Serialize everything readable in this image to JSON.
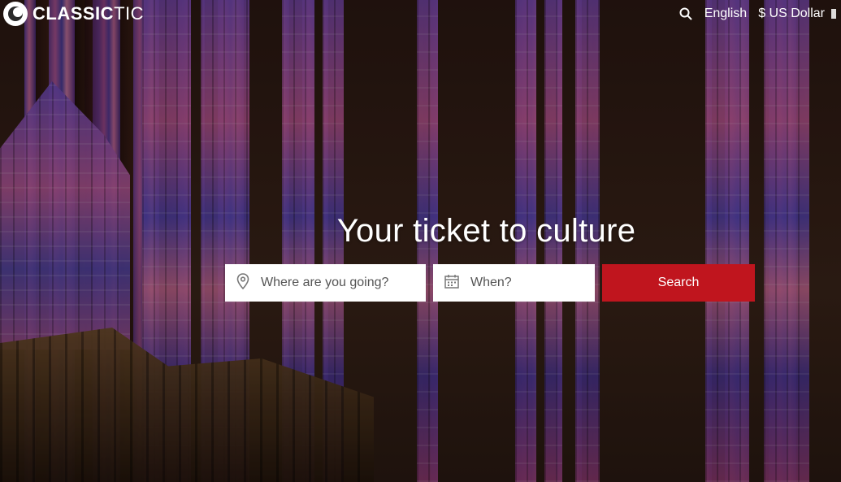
{
  "header": {
    "logo_bold": "CLASSIC",
    "logo_light": "TIC",
    "language": "English",
    "currency": "$ US Dollar",
    "icons": {
      "logo": "classictic-logo-icon",
      "search": "search-icon"
    }
  },
  "hero": {
    "headline": "Your ticket to culture"
  },
  "search": {
    "where_placeholder": "Where are you going?",
    "when_placeholder": "When?",
    "button_label": "Search",
    "icons": {
      "where": "map-pin-icon",
      "when": "calendar-icon"
    }
  },
  "colors": {
    "accent": "#c0151e",
    "header_text": "#ffffff",
    "field_bg": "#ffffff"
  }
}
